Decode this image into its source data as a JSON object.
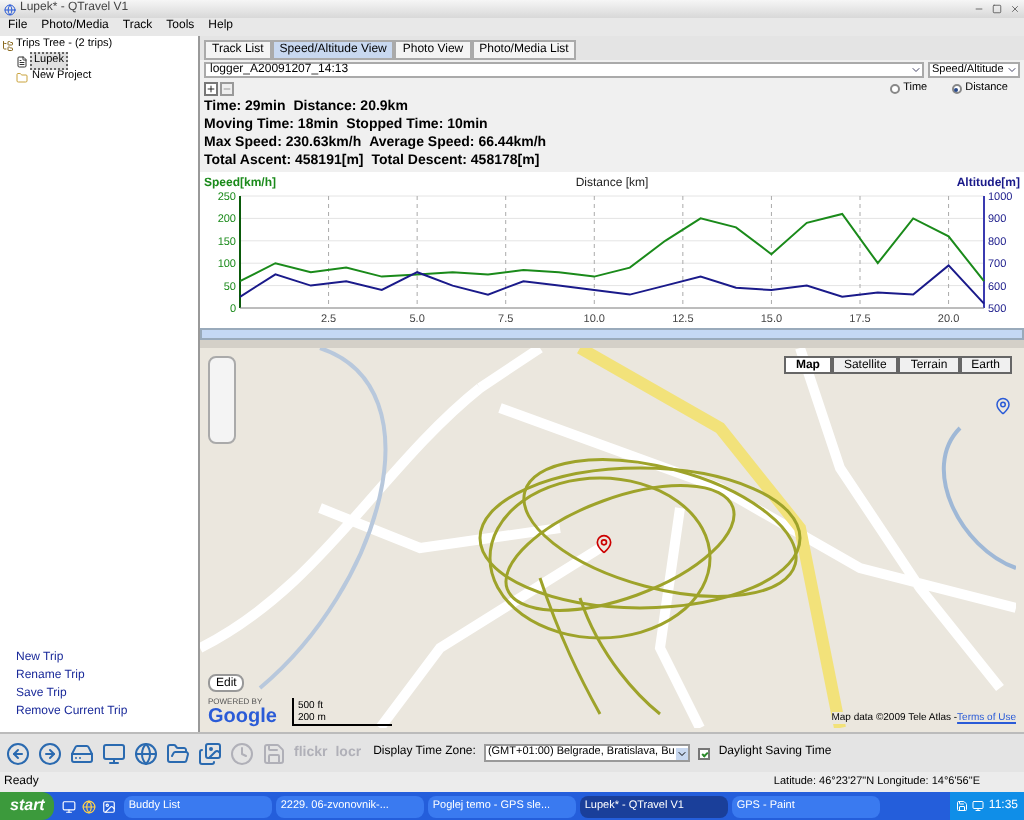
{
  "window": {
    "title": "Lupek* - QTravel V1"
  },
  "menu": [
    "File",
    "Photo/Media",
    "Track",
    "Tools",
    "Help"
  ],
  "tree": {
    "label": "Trips Tree - (2 trips)",
    "children": [
      {
        "label": "Lupek",
        "selected": true
      },
      {
        "label": "New Project",
        "selected": false
      }
    ]
  },
  "trip_actions": [
    "New Trip",
    "Rename Trip",
    "Save Trip",
    "Remove Current Trip"
  ],
  "tabs": [
    {
      "label": "Track List",
      "selected": false
    },
    {
      "label": "Speed/Altitude View",
      "selected": true
    },
    {
      "label": "Photo View",
      "selected": false
    },
    {
      "label": "Photo/Media List",
      "selected": false
    }
  ],
  "track_select": {
    "value": "logger_A20091207_14:13"
  },
  "view_select": {
    "value": "Speed/Altitude"
  },
  "axis_mode": [
    {
      "label": "Time",
      "selected": false
    },
    {
      "label": "Distance",
      "selected": true
    }
  ],
  "stats": [
    [
      "Time: 29min",
      "Distance: 20.9km"
    ],
    [
      "Moving Time: 18min",
      "Stopped Time: 10min"
    ],
    [
      "Max Speed: 230.63km/h",
      "Average Speed: 66.44km/h"
    ],
    [
      "Total Ascent: 458191[m]",
      "Total Descent: 458178[m]"
    ]
  ],
  "chart_data": {
    "type": "line",
    "title": "Distance [km]",
    "grid": true,
    "xlim": [
      0,
      21
    ],
    "ylim": [
      0,
      250
    ],
    "y2lim": [
      500,
      1000
    ],
    "xticks": [
      {
        "value": 2.5,
        "label": "2.5"
      },
      {
        "value": 5,
        "label": "5.0"
      },
      {
        "value": 7.5,
        "label": "7.5"
      },
      {
        "value": 10,
        "label": "10.0"
      },
      {
        "value": 12.5,
        "label": "12.5"
      },
      {
        "value": 15,
        "label": "15.0"
      },
      {
        "value": 17.5,
        "label": "17.5"
      },
      {
        "value": 20,
        "label": "20.0"
      }
    ],
    "yticks": [
      0,
      50,
      100,
      150,
      200,
      250
    ],
    "y2ticks": [
      500,
      600,
      700,
      800,
      900,
      1000
    ],
    "x": [
      0,
      1,
      2,
      3,
      4,
      5,
      6,
      7,
      8,
      9,
      10,
      11,
      12,
      13,
      14,
      15,
      16,
      17,
      18,
      19,
      20,
      21
    ],
    "series": [
      {
        "name": "Speed[km/h]",
        "color": "#1a8a1a",
        "values": [
          60,
          100,
          80,
          90,
          70,
          75,
          80,
          75,
          85,
          80,
          70,
          90,
          150,
          200,
          180,
          120,
          190,
          210,
          100,
          200,
          160,
          60
        ]
      },
      {
        "name": "Altitude[m]",
        "color": "#1a1a8a",
        "axis": "y2",
        "values": [
          550,
          650,
          600,
          620,
          580,
          660,
          600,
          560,
          620,
          600,
          580,
          560,
          600,
          640,
          590,
          580,
          600,
          550,
          570,
          560,
          690,
          520
        ]
      }
    ]
  },
  "map": {
    "types": [
      {
        "label": "Map",
        "selected": true
      },
      {
        "label": "Satellite",
        "selected": false
      },
      {
        "label": "Terrain",
        "selected": false
      },
      {
        "label": "Earth",
        "selected": false
      }
    ],
    "edit": "Edit",
    "powered_by": "POWERED BY",
    "logo": "Google",
    "scale": [
      "500 ft",
      "200 m"
    ],
    "attribution": "Map data ©2009 Tele Atlas - ",
    "terms": "Terms of Use"
  },
  "toolbar": {
    "icons": [
      {
        "kind": "icon",
        "disabled": false
      },
      {
        "kind": "icon",
        "disabled": false
      },
      {
        "kind": "icon",
        "disabled": false
      },
      {
        "kind": "icon",
        "disabled": false
      },
      {
        "kind": "icon",
        "disabled": false
      },
      {
        "kind": "icon",
        "disabled": false
      },
      {
        "kind": "icon",
        "disabled": false
      },
      {
        "kind": "icon",
        "disabled": true
      },
      {
        "kind": "icon",
        "disabled": true
      },
      {
        "kind": "text",
        "label": "flickr",
        "disabled": true
      },
      {
        "kind": "text",
        "label": "locr",
        "disabled": true
      }
    ],
    "timezone_label": "Display Time Zone:",
    "timezone": "(GMT+01:00) Belgrade, Bratislava, Bu",
    "dst": {
      "label": "Daylight Saving Time",
      "checked": true
    }
  },
  "status_bar": {
    "message": "Ready",
    "position": "Latitude: 46°23'27\"N  Longitude: 14°6'56\"E"
  },
  "taskbar": {
    "start": "start",
    "tasks": [
      {
        "label": "Buddy List",
        "selected": false
      },
      {
        "label": "2229. 06-zvonovnik-...",
        "selected": false
      },
      {
        "label": "Poglej temo - GPS sle...",
        "selected": false
      },
      {
        "label": "Lupek* - QTravel V1",
        "selected": true
      },
      {
        "label": "GPS - Paint",
        "selected": false
      }
    ],
    "clock": "11:35"
  }
}
